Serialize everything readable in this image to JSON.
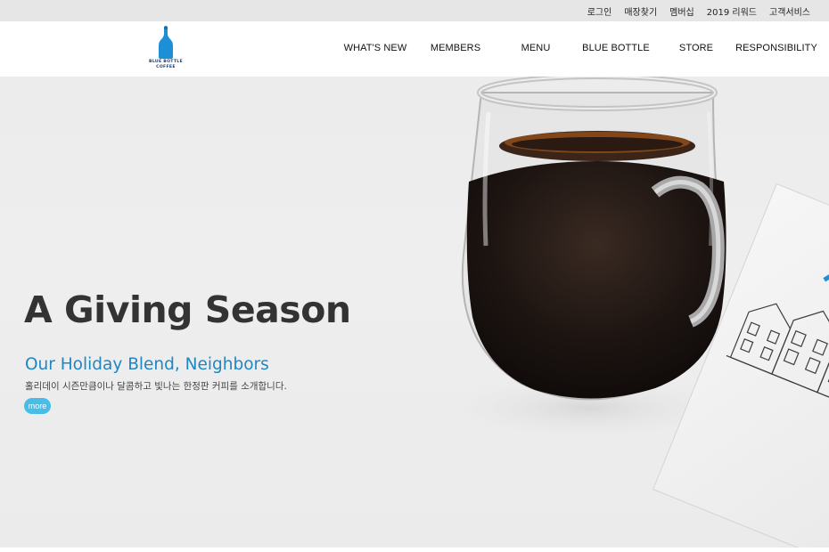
{
  "utility_nav": {
    "login": "로그인",
    "store_finder": "매장찾기",
    "membership": "멤버십",
    "review_2019": "2019 리워드",
    "customer_service": "고객서비스"
  },
  "logo": {
    "line1": "BLUE BOTTLE",
    "line2": "COFFEE",
    "brand_color": "#1d8fd6"
  },
  "main_nav": [
    {
      "label": "WHAT'S NEW"
    },
    {
      "label": "MEMBERS"
    },
    {
      "label": "MENU"
    },
    {
      "label": "BLUE BOTTLE"
    },
    {
      "label": "STORE"
    },
    {
      "label": "RESPONSIBILITY"
    }
  ],
  "hero": {
    "title": "A Giving Season",
    "subtitle": "Our Holiday Blend, Neighbors",
    "description": "홀리데이 시즌만큼이나 달콤하고 빛나는 한정판 커피를 소개합니다.",
    "more_label": "more",
    "accent_color": "#1f86c2",
    "button_color": "#48bde8"
  }
}
